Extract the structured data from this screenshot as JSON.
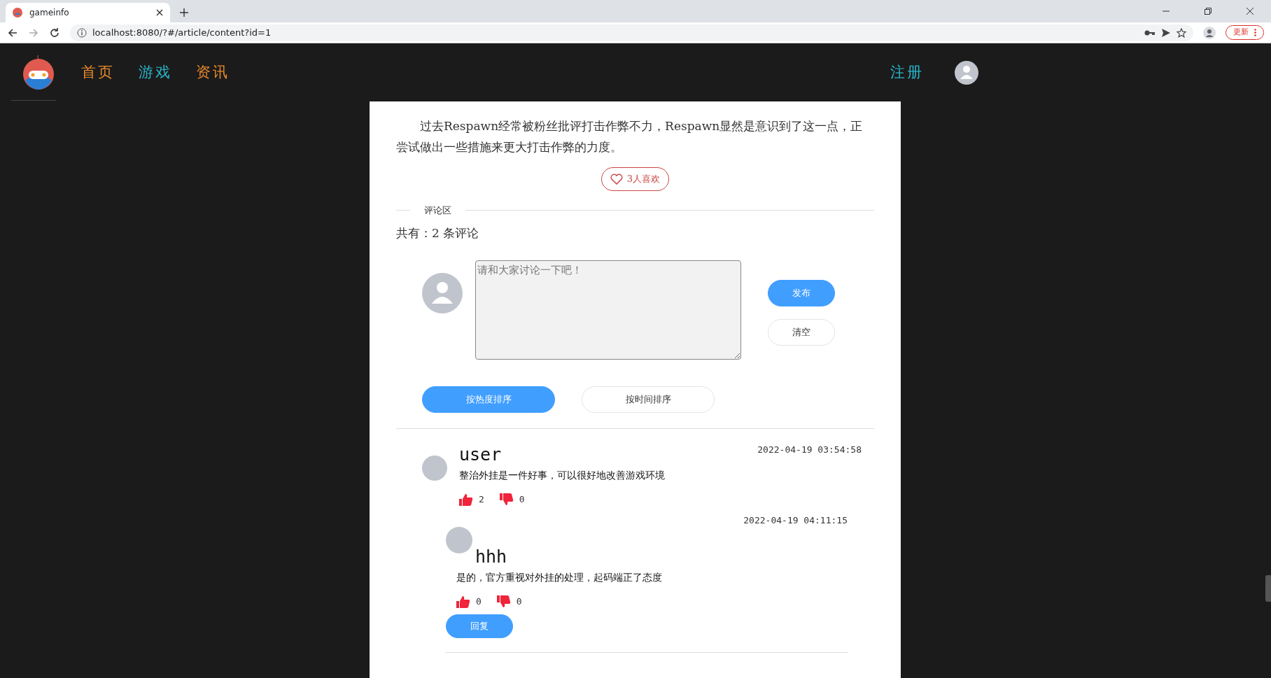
{
  "browser": {
    "tab_title": "gameinfo",
    "url": "localhost:8080/?#/article/content?id=1",
    "update_label": "更新"
  },
  "nav": {
    "links": [
      {
        "label": "首页",
        "color": "#e8892b"
      },
      {
        "label": "游戏",
        "color": "#29b5c9"
      },
      {
        "label": "资讯",
        "color": "#e8892b"
      }
    ],
    "register": "注册"
  },
  "article": {
    "paragraph": "过去Respawn经常被粉丝批评打击作弊不力，Respawn显然是意识到了这一点，正尝试做出一些措施来更大打击作弊的力度。",
    "likes": "3人喜欢"
  },
  "comment_area": {
    "heading": "评论区",
    "count": "共有：2 条评论",
    "placeholder": "请和大家讨论一下吧！",
    "submit": "发布",
    "clear": "清空"
  },
  "sort": [
    {
      "label": "按热度排序",
      "selected": true
    },
    {
      "label": "按时间排序",
      "selected": false
    }
  ],
  "comments": [
    {
      "user": "user",
      "time": "2022-04-19 03:54:58",
      "text": "整治外挂是一件好事，可以很好地改善游戏环境",
      "likes": "2",
      "dislikes": "0",
      "replies": [
        {
          "user": "hhh",
          "time": "2022-04-19 04:11:15",
          "text": "是的，官方重视对外挂的处理，起码端正了态度",
          "likes": "0",
          "dislikes": "0",
          "reply_button": "回复"
        }
      ]
    }
  ]
}
